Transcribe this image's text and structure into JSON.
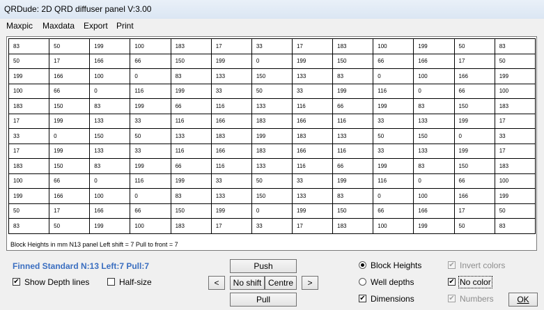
{
  "window": {
    "title": "QRDude: 2D QRD diffuser panel    V:3.00"
  },
  "menu": {
    "items": [
      "Maxpic",
      "Maxdata",
      "Export",
      "Print"
    ]
  },
  "grid": {
    "rows": [
      [
        83,
        50,
        199,
        100,
        183,
        17,
        33,
        17,
        183,
        100,
        199,
        50,
        83
      ],
      [
        50,
        17,
        166,
        66,
        150,
        199,
        0,
        199,
        150,
        66,
        166,
        17,
        50
      ],
      [
        199,
        166,
        100,
        0,
        83,
        133,
        150,
        133,
        83,
        0,
        100,
        166,
        199
      ],
      [
        100,
        66,
        0,
        116,
        199,
        33,
        50,
        33,
        199,
        116,
        0,
        66,
        100
      ],
      [
        183,
        150,
        83,
        199,
        66,
        116,
        133,
        116,
        66,
        199,
        83,
        150,
        183
      ],
      [
        17,
        199,
        133,
        33,
        116,
        166,
        183,
        166,
        116,
        33,
        133,
        199,
        17
      ],
      [
        33,
        0,
        150,
        50,
        133,
        183,
        199,
        183,
        133,
        50,
        150,
        0,
        33
      ],
      [
        17,
        199,
        133,
        33,
        116,
        166,
        183,
        166,
        116,
        33,
        133,
        199,
        17
      ],
      [
        183,
        150,
        83,
        199,
        66,
        116,
        133,
        116,
        66,
        199,
        83,
        150,
        183
      ],
      [
        100,
        66,
        0,
        116,
        199,
        33,
        50,
        33,
        199,
        116,
        0,
        66,
        100
      ],
      [
        199,
        166,
        100,
        0,
        83,
        133,
        150,
        133,
        83,
        0,
        100,
        166,
        199
      ],
      [
        50,
        17,
        166,
        66,
        150,
        199,
        0,
        199,
        150,
        66,
        166,
        17,
        50
      ],
      [
        83,
        50,
        199,
        100,
        183,
        17,
        33,
        17,
        183,
        100,
        199,
        50,
        83
      ]
    ],
    "caption": "Block Heights in mm    N13 panel    Left shift = 7    Pull to front = 7"
  },
  "summary": {
    "text": "Finned Standard   N:13  Left:7  Pull:7"
  },
  "options": {
    "show_depth_lines": {
      "label": "Show Depth lines",
      "checked": true
    },
    "half_size": {
      "label": "Half-size",
      "checked": false
    }
  },
  "buttons": {
    "push": "Push",
    "left": "<",
    "no_shift": "No shift",
    "centre": "Centre",
    "right": ">",
    "pull": "Pull",
    "ok": "OK"
  },
  "display_mode": {
    "block_heights": {
      "label": "Block Heights",
      "selected": true
    },
    "well_depths": {
      "label": "Well depths",
      "selected": false
    },
    "dimensions": {
      "label": "Dimensions",
      "checked": true
    }
  },
  "color_options": {
    "invert_colors": {
      "label": "Invert colors",
      "checked": true,
      "enabled": false
    },
    "no_color": {
      "label": "No color",
      "checked": true,
      "enabled": true
    },
    "numbers": {
      "label": "Numbers",
      "checked": true,
      "enabled": false
    }
  }
}
